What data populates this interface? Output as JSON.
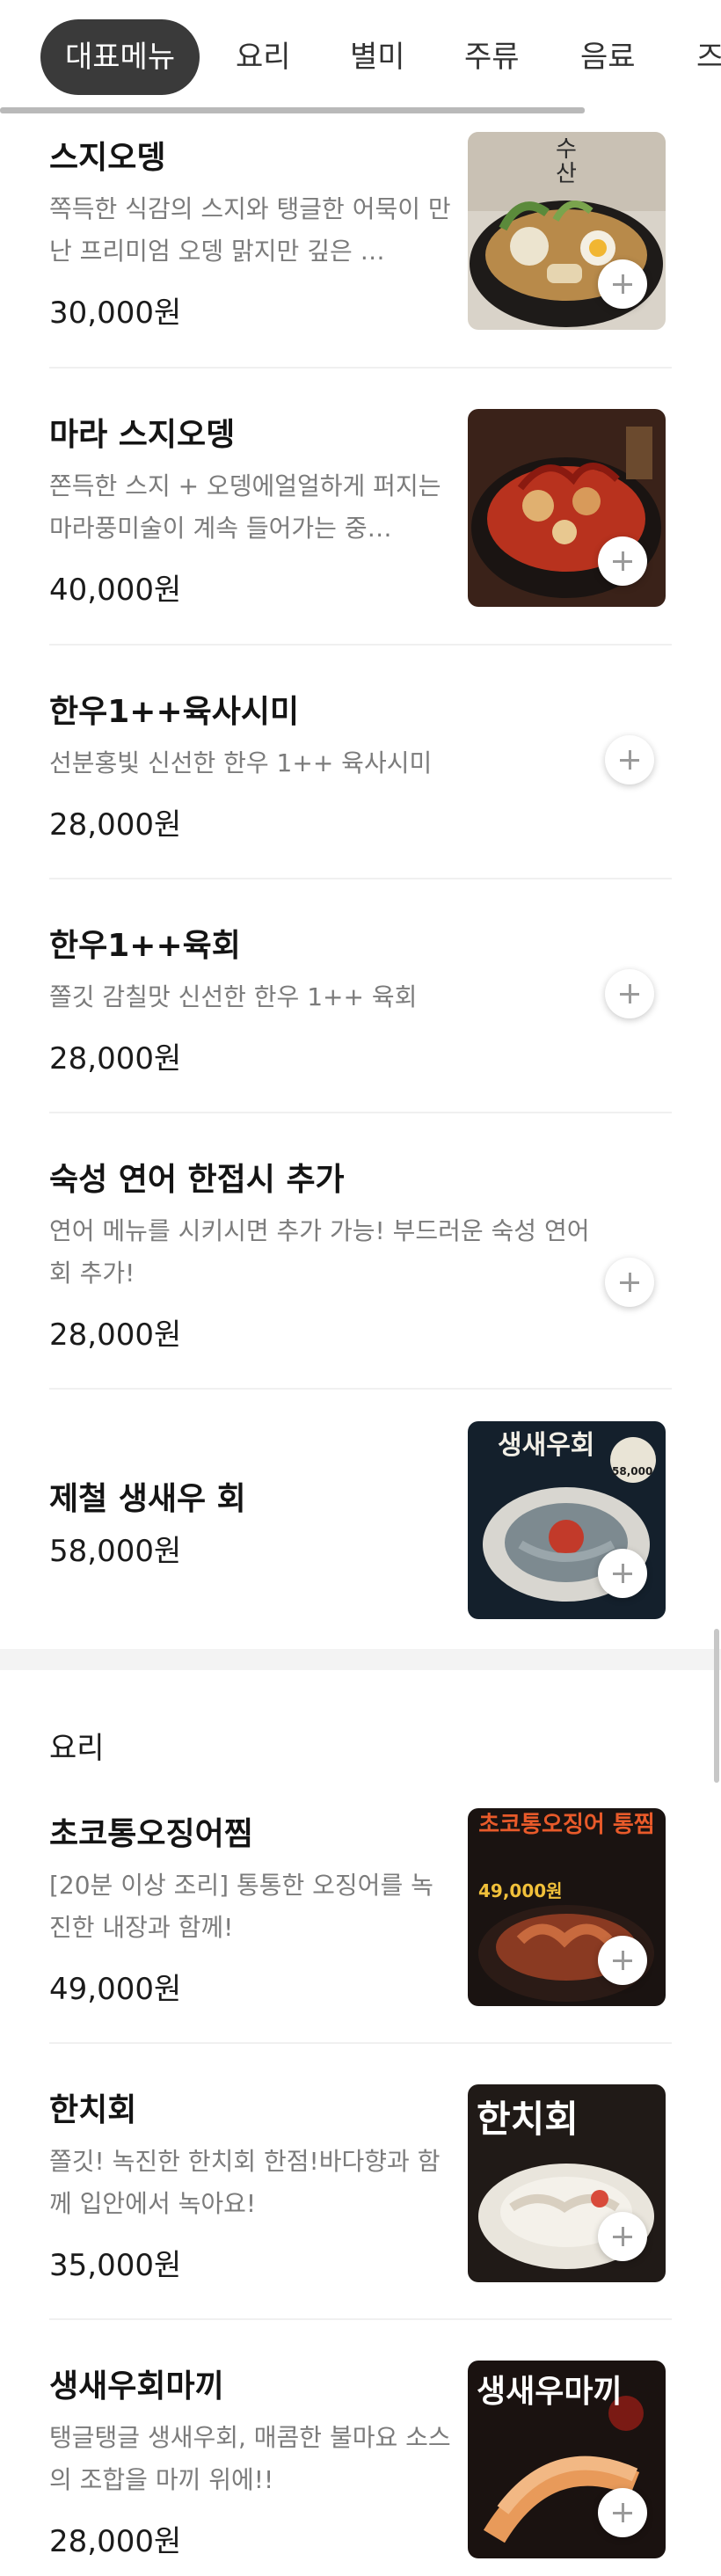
{
  "tabs": [
    {
      "label": "대표메뉴",
      "active": true
    },
    {
      "label": "요리"
    },
    {
      "label": "별미"
    },
    {
      "label": "주류"
    },
    {
      "label": "음료"
    },
    {
      "label": "즈"
    }
  ],
  "sections": [
    {
      "title": "",
      "items": [
        {
          "name": "스지오뎅",
          "description": "쪽득한 식감의 스지와 탱글한 어묵이 만난 프리미엄 오뎅 맑지만 깊은 …",
          "price": "30,000원",
          "image": "oden-pot-photo",
          "image_text": "수산"
        },
        {
          "name": "마라 스지오뎅",
          "description": "쫀득한 스지 + 오뎅에얼얼하게 퍼지는 마라풍미술이 계속 들어가는 중…",
          "price": "40,000원",
          "image": "mala-oden-photo"
        },
        {
          "name": "한우1++육사시미",
          "description": "선분홍빛 신선한 한우 1++ 육사시미",
          "price": "28,000원"
        },
        {
          "name": "한우1++육회",
          "description": "쫄깃 감칠맛 신선한 한우 1++ 육회",
          "price": "28,000원"
        },
        {
          "name": "숙성 연어 한접시 추가",
          "description": "연어 메뉴를 시키시면 추가 가능! 부드러운 숙성 연어회 추가!",
          "price": "28,000원"
        },
        {
          "name": "제철 생새우 회",
          "description": "",
          "price": "58,000원",
          "image": "raw-shrimp-poster",
          "image_text": "생새우회",
          "image_badge": "58,000"
        }
      ]
    },
    {
      "title": "요리",
      "items": [
        {
          "name": "초코통오징어찜",
          "description": "[20분 이상 조리] 통통한 오징어를 녹진한 내장과 함께!",
          "price": "49,000원",
          "image": "squid-stew-poster",
          "image_text": "초코통오징어 통찜",
          "image_badge": "49,000원"
        },
        {
          "name": "한치회",
          "description": "쫄깃! 녹진한 한치회 한점!바다향과 함께 입안에서 녹아요!",
          "price": "35,000원",
          "image": "hanchi-sashimi-poster",
          "image_text": "한치회"
        },
        {
          "name": "생새우회마끼",
          "description": "탱글탱글 생새우회, 매콤한 불마요 소스의 조합을 마끼 위에!!",
          "price": "28,000원",
          "image": "shrimp-maki-poster",
          "image_text": "생새우마끼"
        }
      ]
    }
  ],
  "colors": {
    "accent_tab": "#3a3a3a",
    "text_primary": "#141414",
    "text_secondary": "#7b7b7b",
    "divider": "#f0f0f0"
  }
}
